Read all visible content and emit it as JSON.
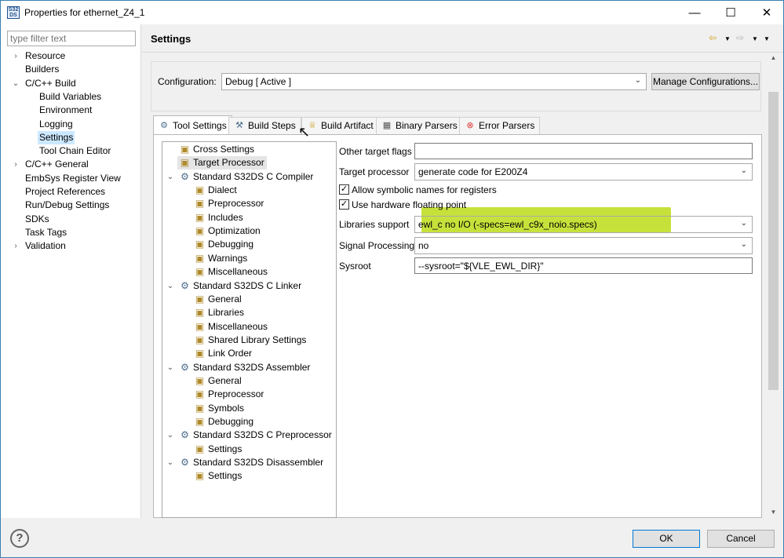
{
  "window": {
    "title": "Properties for ethernet_Z4_1",
    "app_icon_text": "S32\nDS"
  },
  "left_nav": {
    "filter_placeholder": "type filter text",
    "items": [
      {
        "label": "Resource",
        "twisty": "›"
      },
      {
        "label": "Builders",
        "twisty": ""
      },
      {
        "label": "C/C++ Build",
        "twisty": "⌄"
      },
      {
        "label": "Build Variables",
        "twisty": ""
      },
      {
        "label": "Environment",
        "twisty": ""
      },
      {
        "label": "Logging",
        "twisty": ""
      },
      {
        "label": "Settings",
        "twisty": "",
        "selected": true
      },
      {
        "label": "Tool Chain Editor",
        "twisty": ""
      },
      {
        "label": "C/C++ General",
        "twisty": "›"
      },
      {
        "label": "EmbSys Register View",
        "twisty": ""
      },
      {
        "label": "Project References",
        "twisty": ""
      },
      {
        "label": "Run/Debug Settings",
        "twisty": ""
      },
      {
        "label": "SDKs",
        "twisty": ""
      },
      {
        "label": "Task Tags",
        "twisty": ""
      },
      {
        "label": "Validation",
        "twisty": "›"
      }
    ]
  },
  "header": {
    "title": "Settings"
  },
  "configuration": {
    "label": "Configuration:",
    "value": "Debug  [ Active ]",
    "manage_button": "Manage Configurations..."
  },
  "tabs": [
    {
      "label": "Tool Settings",
      "active": true,
      "icon": "tool-settings-icon"
    },
    {
      "label": "Build Steps",
      "active": false,
      "icon": "build-steps-icon"
    },
    {
      "label": "Build Artifact",
      "active": false,
      "icon": "build-artifact-icon"
    },
    {
      "label": "Binary Parsers",
      "active": false,
      "icon": "binary-parsers-icon"
    },
    {
      "label": "Error Parsers",
      "active": false,
      "icon": "error-parsers-icon"
    }
  ],
  "tool_tree": [
    {
      "label": "Cross Settings",
      "twisty": "",
      "icon": "folder-icon"
    },
    {
      "label": "Target Processor",
      "twisty": "",
      "icon": "folder-icon",
      "selected": true
    },
    {
      "label": "Standard S32DS C Compiler",
      "twisty": "⌄",
      "icon": "tool-icon"
    },
    {
      "label": "Dialect",
      "twisty": "",
      "icon": "folder-icon"
    },
    {
      "label": "Preprocessor",
      "twisty": "",
      "icon": "folder-icon"
    },
    {
      "label": "Includes",
      "twisty": "",
      "icon": "folder-icon"
    },
    {
      "label": "Optimization",
      "twisty": "",
      "icon": "folder-icon"
    },
    {
      "label": "Debugging",
      "twisty": "",
      "icon": "folder-icon"
    },
    {
      "label": "Warnings",
      "twisty": "",
      "icon": "folder-icon"
    },
    {
      "label": "Miscellaneous",
      "twisty": "",
      "icon": "folder-icon"
    },
    {
      "label": "Standard S32DS C Linker",
      "twisty": "⌄",
      "icon": "tool-icon"
    },
    {
      "label": "General",
      "twisty": "",
      "icon": "folder-icon"
    },
    {
      "label": "Libraries",
      "twisty": "",
      "icon": "folder-icon"
    },
    {
      "label": "Miscellaneous",
      "twisty": "",
      "icon": "folder-icon"
    },
    {
      "label": "Shared Library Settings",
      "twisty": "",
      "icon": "folder-icon"
    },
    {
      "label": "Link Order",
      "twisty": "",
      "icon": "folder-icon"
    },
    {
      "label": "Standard S32DS Assembler",
      "twisty": "⌄",
      "icon": "tool-icon"
    },
    {
      "label": "General",
      "twisty": "",
      "icon": "folder-icon"
    },
    {
      "label": "Preprocessor",
      "twisty": "",
      "icon": "folder-icon"
    },
    {
      "label": "Symbols",
      "twisty": "",
      "icon": "folder-icon"
    },
    {
      "label": "Debugging",
      "twisty": "",
      "icon": "folder-icon"
    },
    {
      "label": "Standard S32DS C Preprocessor",
      "twisty": "⌄",
      "icon": "tool-icon"
    },
    {
      "label": "Settings",
      "twisty": "",
      "icon": "folder-icon"
    },
    {
      "label": "Standard S32DS Disassembler",
      "twisty": "⌄",
      "icon": "tool-icon"
    },
    {
      "label": "Settings",
      "twisty": "",
      "icon": "folder-icon"
    }
  ],
  "form": {
    "other_target_flags_label": "Other target flags",
    "other_target_flags_value": "",
    "target_processor_label": "Target processor",
    "target_processor_value": "generate code for E200Z4",
    "symbolic_names_label": "Allow symbolic names for registers",
    "symbolic_names_checked": "✓",
    "hw_float_label": "Use hardware floating point",
    "hw_float_checked": "✓",
    "libraries_support_label": "Libraries support",
    "libraries_support_value": "ewl_c no I/O (-specs=ewl_c9x_noio.specs)",
    "signal_processing_label": "Signal Processing",
    "signal_processing_value": "no",
    "sysroot_label": "Sysroot",
    "sysroot_value": "--sysroot=\"${VLE_EWL_DIR}\""
  },
  "footer": {
    "ok": "OK",
    "cancel": "Cancel"
  },
  "colors": {
    "highlight": "#c7e13b",
    "selection": "#cce8ff",
    "accent": "#0078d7"
  }
}
